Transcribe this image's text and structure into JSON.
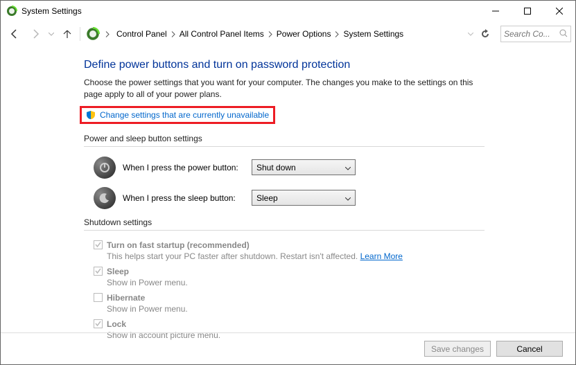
{
  "window": {
    "title": "System Settings"
  },
  "breadcrumbs": {
    "items": [
      "Control Panel",
      "All Control Panel Items",
      "Power Options",
      "System Settings"
    ]
  },
  "search": {
    "placeholder": "Search Co..."
  },
  "page": {
    "heading": "Define power buttons and turn on password protection",
    "intro": "Choose the power settings that you want for your computer. The changes you make to the settings on this page apply to all of your power plans.",
    "change_link": "Change settings that are currently unavailable"
  },
  "section": {
    "button_settings_title": "Power and sleep button settings",
    "power_button_label": "When I press the power button:",
    "power_button_value": "Shut down",
    "sleep_button_label": "When I press the sleep button:",
    "sleep_button_value": "Sleep",
    "shutdown_title": "Shutdown settings"
  },
  "options": {
    "fast_startup": {
      "title": "Turn on fast startup (recommended)",
      "desc_prefix": "This helps start your PC faster after shutdown. Restart isn't affected. ",
      "learn_more": "Learn More"
    },
    "sleep": {
      "title": "Sleep",
      "desc": "Show in Power menu."
    },
    "hibernate": {
      "title": "Hibernate",
      "desc": "Show in Power menu."
    },
    "lock": {
      "title": "Lock",
      "desc": "Show in account picture menu."
    }
  },
  "footer": {
    "save": "Save changes",
    "cancel": "Cancel"
  }
}
